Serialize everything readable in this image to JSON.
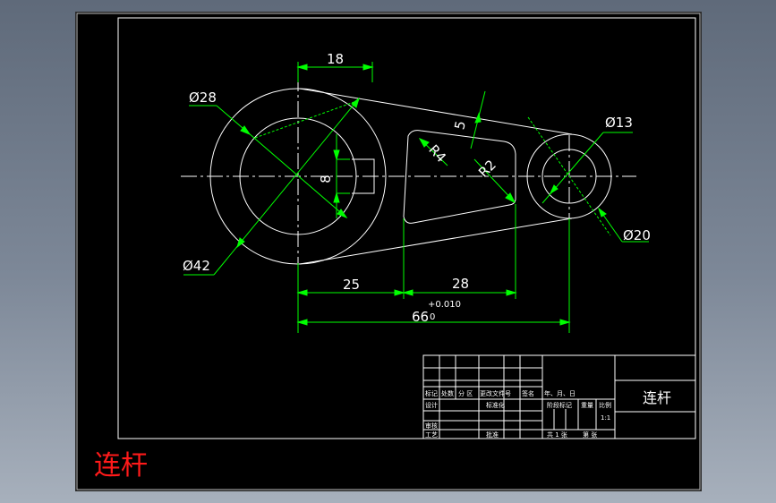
{
  "drawing": {
    "part_name": "连杆",
    "caption": "连杆",
    "colors": {
      "background": "#000000",
      "outline": "#ffffff",
      "dimension": "#00ff00",
      "centerline": "#ffffff",
      "caption": "#ff1a1a"
    },
    "dimensions": {
      "d28": "Ø28",
      "d42": "Ø42",
      "d13": "Ø13",
      "d20": "Ø20",
      "top18": "18",
      "key8": "8",
      "slot5": "5",
      "r4": "R4",
      "r2": "R2",
      "h25": "25",
      "h28": "28",
      "total66": "66",
      "tol_upper": "+0.010",
      "tol_lower": "0"
    }
  },
  "title_block": {
    "part_name": "连杆",
    "scale": "1:1",
    "row_labels": [
      "标记",
      "处数",
      "分 区",
      "更改文件号",
      "签名",
      "年、月、日"
    ],
    "design": "设计",
    "standardize": "标准化",
    "review": "审核",
    "process": "工艺",
    "approve": "批准",
    "stage_mark": "阶段标记",
    "weight": "重量",
    "ratio": "比例",
    "total_sheets": "共 1 张",
    "sheet_no": "第 张"
  }
}
